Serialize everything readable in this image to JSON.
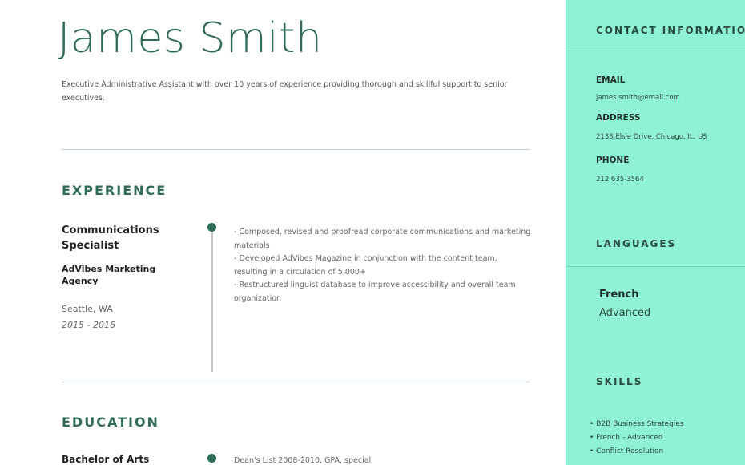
{
  "header": {
    "name": "James Smith",
    "summary": "Executive Administrative Assistant with over 10 years of experience providing thorough and skillful support to senior executives."
  },
  "experience": {
    "title": "EXPERIENCE",
    "job": {
      "title": "Communications Specialist",
      "company": "AdVibes Marketing Agency",
      "location": "Seattle, WA",
      "dates": "2015 - 2016",
      "bullets": [
        "- Composed, revised and proofread corporate communications and marketing materials",
        "- Developed AdVibes Magazine in conjunction with the content team, resulting in a circulation of 5,000+",
        "- Restructured linguist database to improve accessibility and overall team organization"
      ]
    }
  },
  "education": {
    "title": "EDUCATION",
    "degree": "Bachelor of Arts",
    "detail": "Dean's List 2008-2010, GPA, special"
  },
  "sidebar": {
    "contact": {
      "title": "CONTACT INFORMATION",
      "email_label": "EMAIL",
      "email": "james.smith@email.com",
      "address_label": "ADDRESS",
      "address": "2133 Elsie Drive, Chicago, IL, US",
      "phone_label": "PHONE",
      "phone": "212 635-3564"
    },
    "languages": {
      "title": "LANGUAGES",
      "name": "French",
      "level": "Advanced"
    },
    "skills": {
      "title": "SKILLS",
      "items": [
        "• B2B Business Strategies",
        "• French - Advanced",
        "• Conflict Resolution"
      ]
    }
  },
  "colors": {
    "accent": "#2f6b57",
    "sidebar_bg": "#8ff2d4"
  }
}
